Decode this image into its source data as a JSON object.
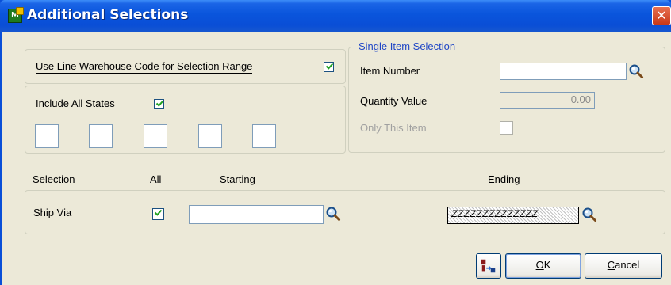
{
  "window": {
    "title": "Additional Selections",
    "app_icon": "sage-mas-icon",
    "close_glyph": "✕"
  },
  "warehouse_panel": {
    "label": "Use Line Warehouse Code for Selection Range",
    "checked": true
  },
  "states_panel": {
    "label": "Include All States",
    "checked": true,
    "state_boxes": [
      "",
      "",
      "",
      "",
      ""
    ]
  },
  "single_item": {
    "legend": "Single Item Selection",
    "item_number_label": "Item Number",
    "item_number_value": "",
    "quantity_label": "Quantity Value",
    "quantity_value": "0.00",
    "only_this_item_label": "Only This Item",
    "only_this_item_checked": false
  },
  "selection_grid": {
    "headers": {
      "selection": "Selection",
      "all": "All",
      "starting": "Starting",
      "ending": "Ending"
    },
    "rows": [
      {
        "selection": "Ship Via",
        "all_checked": true,
        "starting": "",
        "ending": "ZZZZZZZZZZZZZZ"
      }
    ]
  },
  "buttons": {
    "lookup_icon": "magnifier-icon",
    "copy_icon": "copy-selection-icon",
    "ok_prefix": "",
    "ok_mnemonic": "O",
    "ok_rest": "K",
    "cancel_mnemonic": "C",
    "cancel_rest": "ancel"
  },
  "colors": {
    "title_bar": "#0a4fd8",
    "client_bg": "#ece9d8",
    "legend_text": "#1f46c6",
    "checkmark": "#21a121",
    "close_button": "#c83818"
  }
}
